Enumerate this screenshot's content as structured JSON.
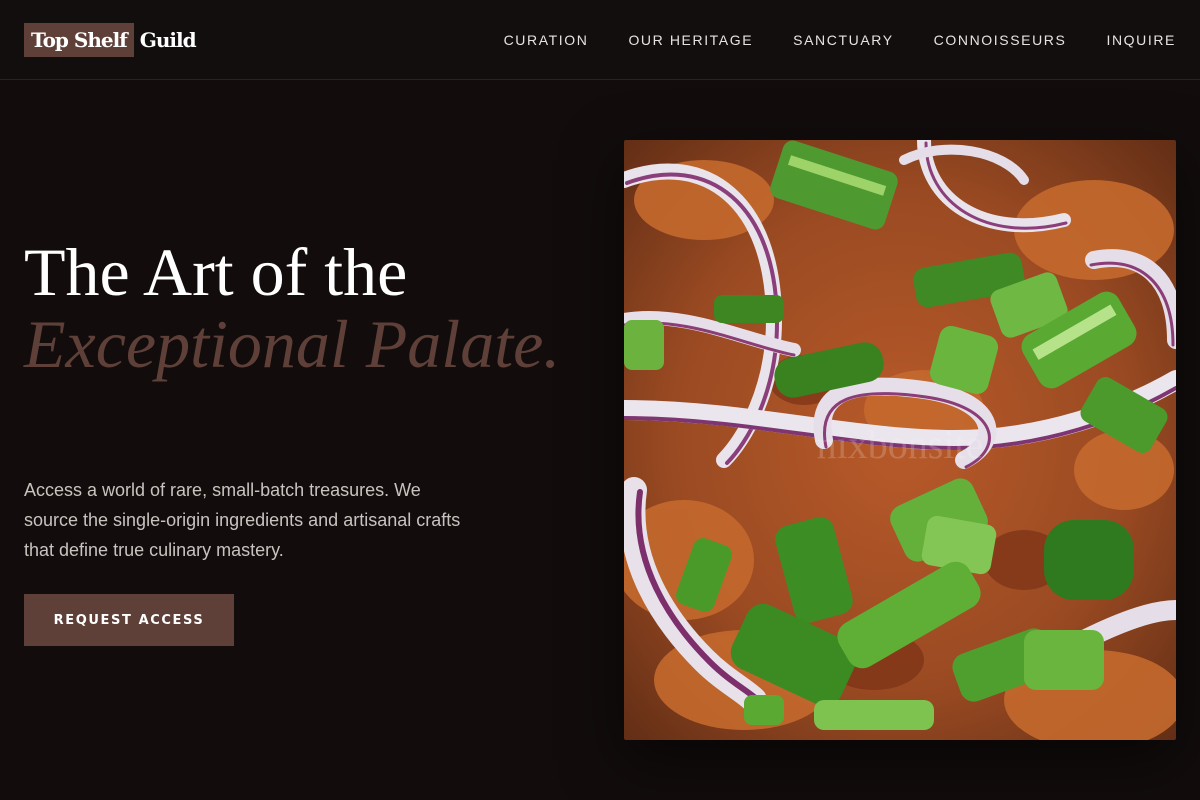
{
  "brand": {
    "part1": "Top Shelf",
    "part2": "Guild"
  },
  "nav": {
    "items": [
      {
        "label": "CURATION"
      },
      {
        "label": "OUR HERITAGE"
      },
      {
        "label": "SANCTUARY"
      },
      {
        "label": "CONNOISSEURS"
      },
      {
        "label": "INQUIRE"
      }
    ]
  },
  "hero": {
    "title_line1": "The Art of the",
    "title_line2": "Exceptional Palate.",
    "description": "Access a world of rare, small-batch treasures. We source the single-origin ingredients and artisanal crafts that define true culinary mastery.",
    "cta_label": "REQUEST ACCESS"
  },
  "colors": {
    "background": "#120d0c",
    "accent": "#5f4039",
    "text_primary": "#ffffff",
    "text_secondary": "#c9c2bf"
  }
}
